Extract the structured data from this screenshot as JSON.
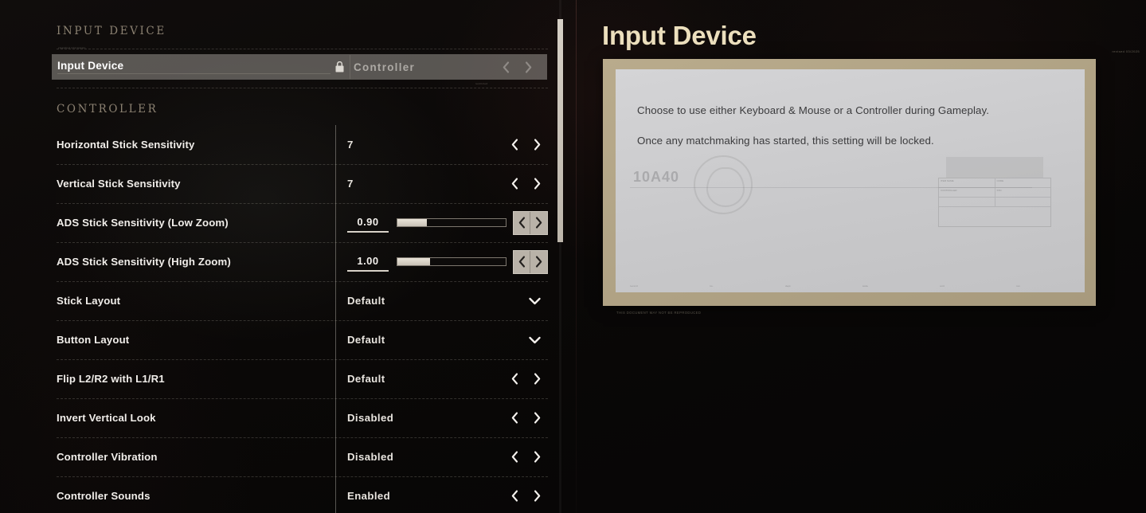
{
  "sections": [
    {
      "id": "input-device",
      "title": "INPUT DEVICE"
    },
    {
      "id": "controller",
      "title": "CONTROLLER"
    }
  ],
  "locked_row": {
    "label": "Input Device",
    "value": "Controller",
    "lock_icon": "lock-icon",
    "prev_icon": "chevron-left-icon",
    "next_icon": "chevron-right-icon",
    "scrap_top": "classified information",
    "scrap_bottom": "restricted"
  },
  "controller_rows": [
    {
      "label": "Horizontal Stick Sensitivity",
      "value": "7",
      "control": "stepper"
    },
    {
      "label": "Vertical Stick Sensitivity",
      "value": "7",
      "control": "stepper"
    },
    {
      "label": "ADS Stick Sensitivity (Low Zoom)",
      "value": "0.90",
      "control": "slider",
      "fill_percent": 27
    },
    {
      "label": "ADS Stick Sensitivity (High Zoom)",
      "value": "1.00",
      "control": "slider",
      "fill_percent": 30
    },
    {
      "label": "Stick Layout",
      "value": "Default",
      "control": "dropdown"
    },
    {
      "label": "Button Layout",
      "value": "Default",
      "control": "dropdown"
    },
    {
      "label": "Flip L2/R2 with L1/R1",
      "value": "Default",
      "control": "stepper"
    },
    {
      "label": "Invert Vertical Look",
      "value": "Disabled",
      "control": "stepper"
    },
    {
      "label": "Controller Vibration",
      "value": "Disabled",
      "control": "stepper"
    },
    {
      "label": "Controller Sounds",
      "value": "Enabled",
      "control": "stepper"
    }
  ],
  "info": {
    "title": "Input Device",
    "description_line_1": "Choose to use either Keyboard & Mouse or a Controller during Gameplay.",
    "description_line_2": "Once any matchmaking has started, this setting will be locked.",
    "watermark": "10A40",
    "top_note": "revised  03/2025",
    "below_note": "THIS DOCUMENT MAY NOT BE REPRODUCED",
    "footer_cells": [
      "record",
      "no.",
      "dept",
      "code",
      "unit",
      "rev",
      "file"
    ],
    "table_cells": [
      [
        "ITEM NAME",
        "CODE"
      ],
      [
        "CONTROLLER",
        "STD"
      ]
    ]
  },
  "colors": {
    "accent_title": "#ecdfbd",
    "section_header": "#8c8272",
    "row_label": "#f1eeea",
    "doc_border": "#b9ab8c",
    "doc_paper": "#cdcdcf"
  }
}
